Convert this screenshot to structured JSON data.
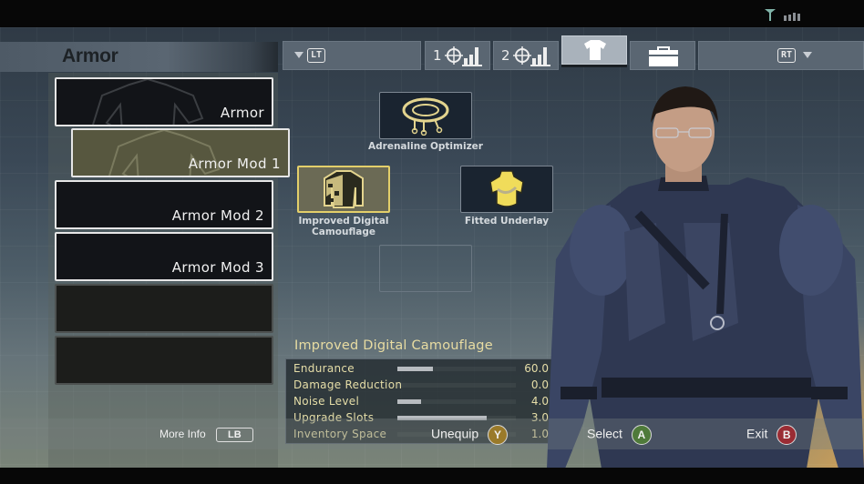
{
  "status_bar": {
    "icons": [
      "signal-tower-icon",
      "signal-bars-icon"
    ]
  },
  "panel": {
    "title": "Armor"
  },
  "tabs": {
    "left_trigger": "LT",
    "right_trigger": "RT",
    "items": [
      {
        "id": "weapon-1",
        "number": "1",
        "icon": "primary-weapon-icon"
      },
      {
        "id": "weapon-2",
        "number": "2",
        "icon": "secondary-weapon-icon"
      },
      {
        "id": "armor",
        "icon": "armor-shirt-icon",
        "selected": true
      },
      {
        "id": "inventory",
        "icon": "briefcase-icon"
      }
    ]
  },
  "slots": [
    {
      "label": "Armor",
      "filled": true,
      "active": false
    },
    {
      "label": "Armor Mod 1",
      "filled": true,
      "active": true
    },
    {
      "label": "Armor Mod 2",
      "filled": true,
      "active": false
    },
    {
      "label": "Armor Mod 3",
      "filled": true,
      "active": false
    },
    {
      "label": "",
      "filled": false,
      "active": false
    },
    {
      "label": "",
      "filled": false,
      "active": false
    }
  ],
  "mods": {
    "top": {
      "name": "Adrenaline Optimizer",
      "icon": "adrenaline-optimizer-icon"
    },
    "left": {
      "name": "Improved Digital Camouflage",
      "name_line1": "Improved Digital",
      "name_line2": "Camouflage",
      "icon": "digital-camouflage-icon",
      "selected": true
    },
    "right": {
      "name": "Fitted Underlay",
      "icon": "fitted-underlay-icon"
    },
    "bottom": {
      "name": "",
      "empty": true
    }
  },
  "stats": {
    "title": "Improved Digital Camouflage",
    "rows": [
      {
        "name": "Endurance",
        "value": "60.0",
        "fill": 0.3
      },
      {
        "name": "Damage Reduction",
        "value": "0.0",
        "fill": 0.0
      },
      {
        "name": "Noise Level",
        "value": "4.0",
        "fill": 0.2
      },
      {
        "name": "Upgrade Slots",
        "value": "3.0",
        "fill": 0.75
      },
      {
        "name": "Inventory Space",
        "value": "1.0",
        "fill": 0.0
      }
    ]
  },
  "footer": {
    "more_info": {
      "label": "More Info",
      "button": "LB"
    },
    "unequip": {
      "label": "Unequip",
      "button": "Y",
      "color": "#9a7a2a"
    },
    "select": {
      "label": "Select",
      "button": "A",
      "color": "#4f7a3a"
    },
    "exit": {
      "label": "Exit",
      "button": "B",
      "color": "#9a2c34"
    }
  },
  "colors": {
    "accent": "#e3cf6a",
    "stat_text": "#e6dea8"
  }
}
